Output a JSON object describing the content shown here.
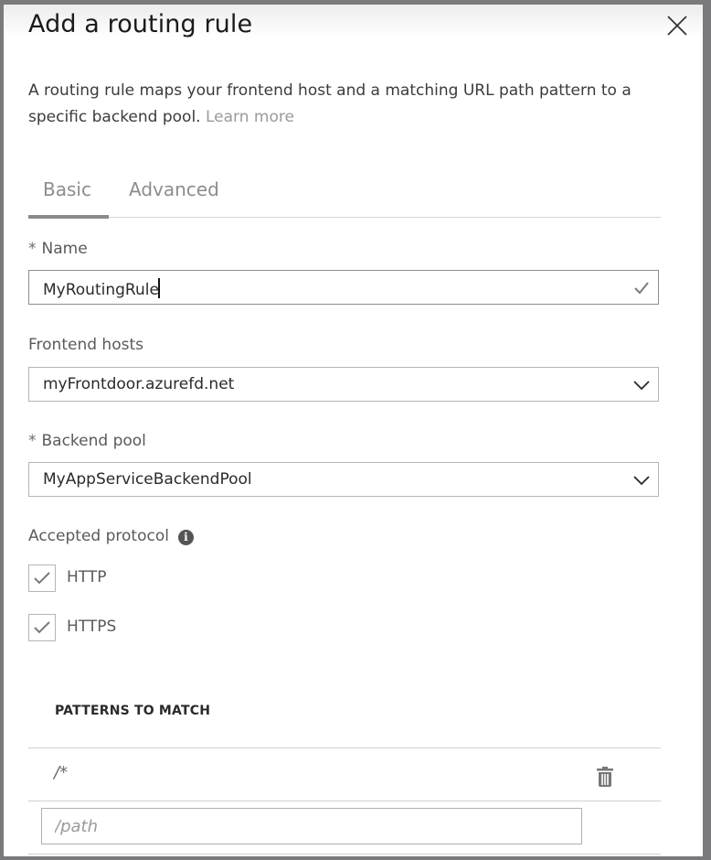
{
  "dialog": {
    "title": "Add a routing rule",
    "close_icon": "close-icon",
    "description": "A routing rule maps your frontend host and a matching URL path pattern to a specific backend pool.",
    "learn_more": "Learn more"
  },
  "tabs": [
    {
      "label": "Basic",
      "active": true
    },
    {
      "label": "Advanced",
      "active": false
    }
  ],
  "form": {
    "name": {
      "required_marker": "*",
      "label": "Name",
      "value": "MyRoutingRule",
      "status_icon": "checkmark-icon"
    },
    "frontend_hosts": {
      "label": "Frontend hosts",
      "value": "myFrontdoor.azurefd.net",
      "icon": "chevron-down-icon"
    },
    "backend_pool": {
      "required_marker": "*",
      "label": "Backend pool",
      "value": "MyAppServiceBackendPool",
      "icon": "chevron-down-icon"
    },
    "accepted_protocol": {
      "label": "Accepted protocol",
      "info_icon": "info-icon",
      "info_glyph": "i",
      "options": [
        {
          "label": "HTTP",
          "checked": true
        },
        {
          "label": "HTTPS",
          "checked": true
        }
      ]
    }
  },
  "patterns": {
    "title": "PATTERNS TO MATCH",
    "items": [
      {
        "value": "/*",
        "action_icon": "trash-icon"
      }
    ],
    "new_input": {
      "value": "",
      "placeholder": "/path"
    }
  }
}
